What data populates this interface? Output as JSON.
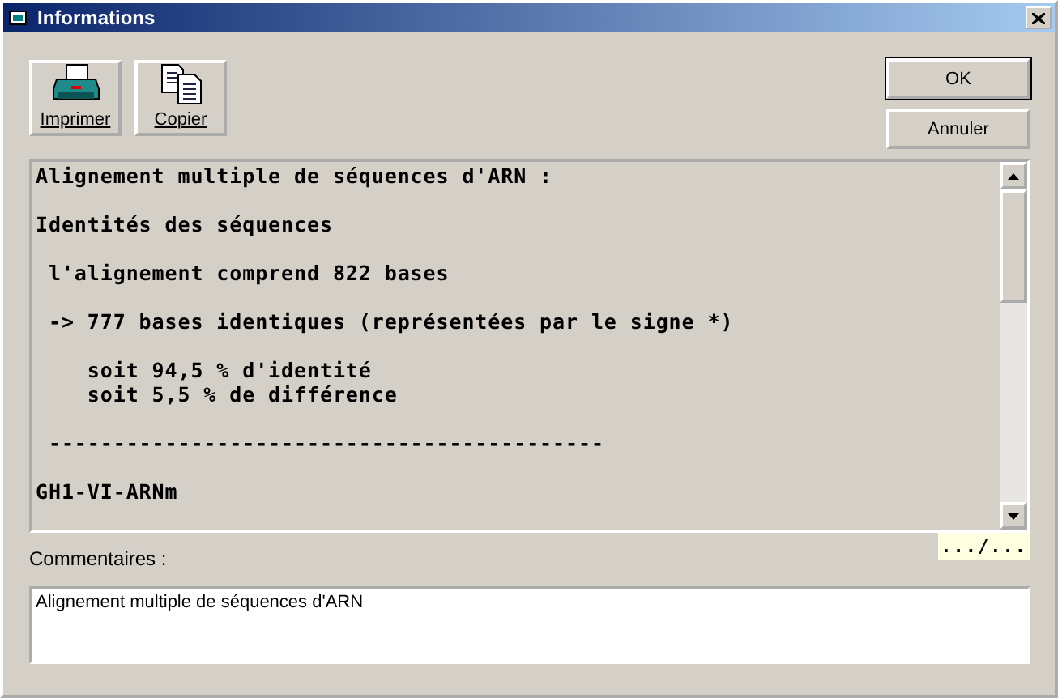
{
  "window": {
    "title": "Informations"
  },
  "toolbar": [
    {
      "kind": "print",
      "label": "Imprimer"
    },
    {
      "kind": "copy",
      "label": "Copier"
    }
  ],
  "dialog_buttons": [
    {
      "label": "OK",
      "default": true
    },
    {
      "label": "Annuler",
      "default": false
    }
  ],
  "report": {
    "paragraphs": [
      [
        "Alignement multiple de séquences d'ARN :"
      ],
      [
        "Identités des séquences"
      ],
      [
        " l'alignement comprend 822 bases"
      ],
      [
        " -> 777 bases identiques (représentées par le signe *)"
      ],
      [
        "    soit 94,5 % d'identité",
        "    soit 5,5 % de différence"
      ],
      [
        " -------------------------------------------"
      ],
      [
        "GH1-VI-ARNm"
      ]
    ],
    "page_indicator": ".../..."
  },
  "comments": {
    "label": "Commentaires :",
    "value": "Alignement multiple de séquences d'ARN"
  }
}
